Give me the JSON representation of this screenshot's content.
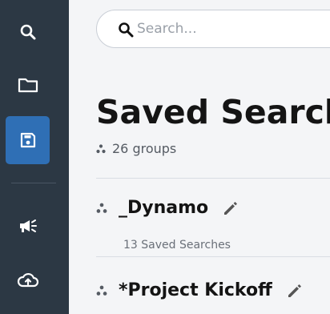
{
  "sidebar": {
    "items": [
      {
        "icon": "search-icon",
        "active": false
      },
      {
        "icon": "folder-icon",
        "active": false
      },
      {
        "icon": "save-icon",
        "active": true
      },
      {
        "icon": "megaphone-icon",
        "active": false
      },
      {
        "icon": "cloud-upload-icon",
        "active": false
      }
    ],
    "active_color": "#2f6fb5",
    "background": "#2c3844"
  },
  "search": {
    "placeholder": "Search...",
    "value": ""
  },
  "page": {
    "title": "Saved Searches",
    "groups_count": "26 groups"
  },
  "groups": [
    {
      "name": "_Dynamo",
      "saved_count": "13 Saved Searches"
    },
    {
      "name": "*Project Kickoff",
      "saved_count": ""
    }
  ]
}
